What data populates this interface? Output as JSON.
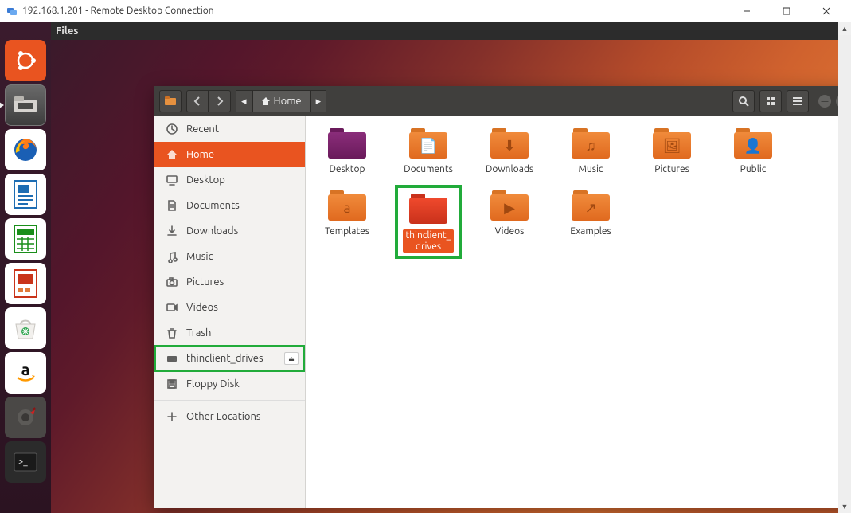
{
  "rdp": {
    "title": "192.168.1.201 - Remote Desktop Connection"
  },
  "gnome": {
    "app_menu": "Files"
  },
  "launcher": {
    "items": [
      {
        "name": "ubuntu-dash",
        "style": "li-ubuntu"
      },
      {
        "name": "files",
        "style": "li-files",
        "running": true
      },
      {
        "name": "firefox",
        "style": "li-white"
      },
      {
        "name": "libreoffice-writer",
        "style": "li-blue"
      },
      {
        "name": "libreoffice-calc",
        "style": "li-green"
      },
      {
        "name": "libreoffice-impress",
        "style": "li-orange"
      },
      {
        "name": "ubuntu-software",
        "style": "li-white"
      },
      {
        "name": "amazon",
        "style": "li-white"
      },
      {
        "name": "settings",
        "style": "li-dark"
      },
      {
        "name": "terminal",
        "style": "li-dark"
      }
    ]
  },
  "nautilus": {
    "path": {
      "location": "Home"
    },
    "sidebar": {
      "items": [
        {
          "icon": "clock",
          "label": "Recent"
        },
        {
          "icon": "home",
          "label": "Home",
          "active": true
        },
        {
          "icon": "desktop",
          "label": "Desktop"
        },
        {
          "icon": "doc",
          "label": "Documents"
        },
        {
          "icon": "download",
          "label": "Downloads"
        },
        {
          "icon": "music",
          "label": "Music"
        },
        {
          "icon": "camera",
          "label": "Pictures"
        },
        {
          "icon": "video",
          "label": "Videos"
        },
        {
          "icon": "trash",
          "label": "Trash"
        },
        {
          "icon": "drive",
          "label": "thinclient_drives",
          "eject": true,
          "highlight": true
        },
        {
          "icon": "floppy",
          "label": "Floppy Disk"
        }
      ],
      "other": {
        "icon": "plus",
        "label": "Other Locations"
      }
    },
    "grid": [
      {
        "label": "Desktop",
        "kind": "folder-purple",
        "glyph": ""
      },
      {
        "label": "Documents",
        "kind": "folder",
        "glyph": "📄"
      },
      {
        "label": "Downloads",
        "kind": "folder",
        "glyph": "⬇"
      },
      {
        "label": "Music",
        "kind": "folder",
        "glyph": "♫"
      },
      {
        "label": "Pictures",
        "kind": "folder",
        "glyph": "🖼"
      },
      {
        "label": "Public",
        "kind": "folder",
        "glyph": "👤"
      },
      {
        "label": "Templates",
        "kind": "folder",
        "glyph": "a"
      },
      {
        "label": "thinclient_\ndrives",
        "kind": "folder-red",
        "glyph": "",
        "selected": true,
        "highlight": true
      },
      {
        "label": "Videos",
        "kind": "folder",
        "glyph": "▶"
      },
      {
        "label": "Examples",
        "kind": "folder",
        "glyph": "↗"
      }
    ]
  }
}
